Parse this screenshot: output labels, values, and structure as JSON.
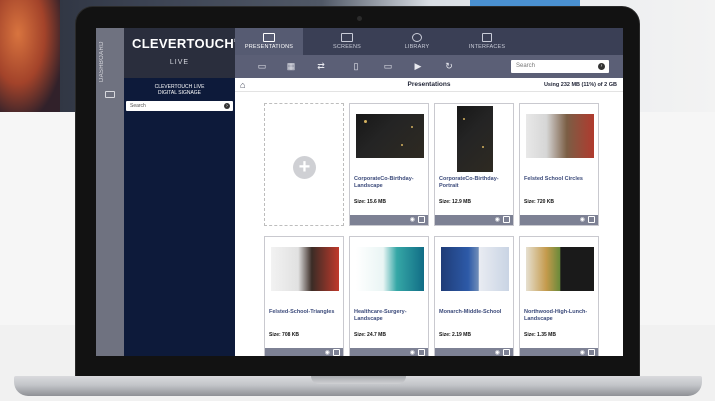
{
  "app": {
    "brand": "CLEVERTOUCH",
    "brand_mark": "®",
    "brand_sub": "LIVE",
    "rail_label": "DASHBOARD"
  },
  "sidebar": {
    "header_line1": "CLEVERTOUCH LIVE",
    "header_line2": "DIGITAL SIGNAGE",
    "search_placeholder": "Search"
  },
  "nav": {
    "tabs": [
      {
        "label": "PRESENTATIONS",
        "icon": "presentation-icon",
        "active": true
      },
      {
        "label": "SCREENS",
        "icon": "monitor-icon",
        "active": false
      },
      {
        "label": "LIBRARY",
        "icon": "library-icon",
        "active": false
      },
      {
        "label": "INTERFACES",
        "icon": "interfaces-icon",
        "active": false
      }
    ]
  },
  "toolbar": {
    "icons": [
      "slides-icon",
      "calendar-icon",
      "share-icon",
      "mobile-icon",
      "display-icon",
      "video-icon",
      "refresh-icon"
    ],
    "search_placeholder": "Search"
  },
  "main": {
    "title": "Presentations",
    "usage": "Using 232 MB (11%) of 2 GB"
  },
  "presentations": [
    {
      "name": "CorporateCo-Birthday-Landscape",
      "size": "Size: 15.6 MB",
      "thumb": "t-b1",
      "portrait": false
    },
    {
      "name": "CorporateCo-Birthday-Portrait",
      "size": "Size: 12.9 MB",
      "thumb": "t-b1",
      "portrait": true
    },
    {
      "name": "Felsted School Circles",
      "size": "Size: 720 KB",
      "thumb": "t-school",
      "portrait": false
    },
    {
      "name": "Felsted-School-Triangles",
      "size": "Size: 708 KB",
      "thumb": "t-tri",
      "portrait": false
    },
    {
      "name": "Healthcare-Surgery-Landscape",
      "size": "Size: 24.7 MB",
      "thumb": "t-health",
      "portrait": false
    },
    {
      "name": "Monarch-Middle-School",
      "size": "Size: 2.19 MB",
      "thumb": "t-mon",
      "portrait": false
    },
    {
      "name": "Northwood-High-Lunch-Landscape",
      "size": "Size: 1.35 MB",
      "thumb": "t-nhl",
      "portrait": false
    }
  ],
  "colors": {
    "nav_bg": "#3a3f55",
    "toolbar_bg": "#5b5f76",
    "sidebar_bg": "#0d1a3a",
    "card_footer": "#7d8194",
    "title_link": "#3b4a7a"
  }
}
